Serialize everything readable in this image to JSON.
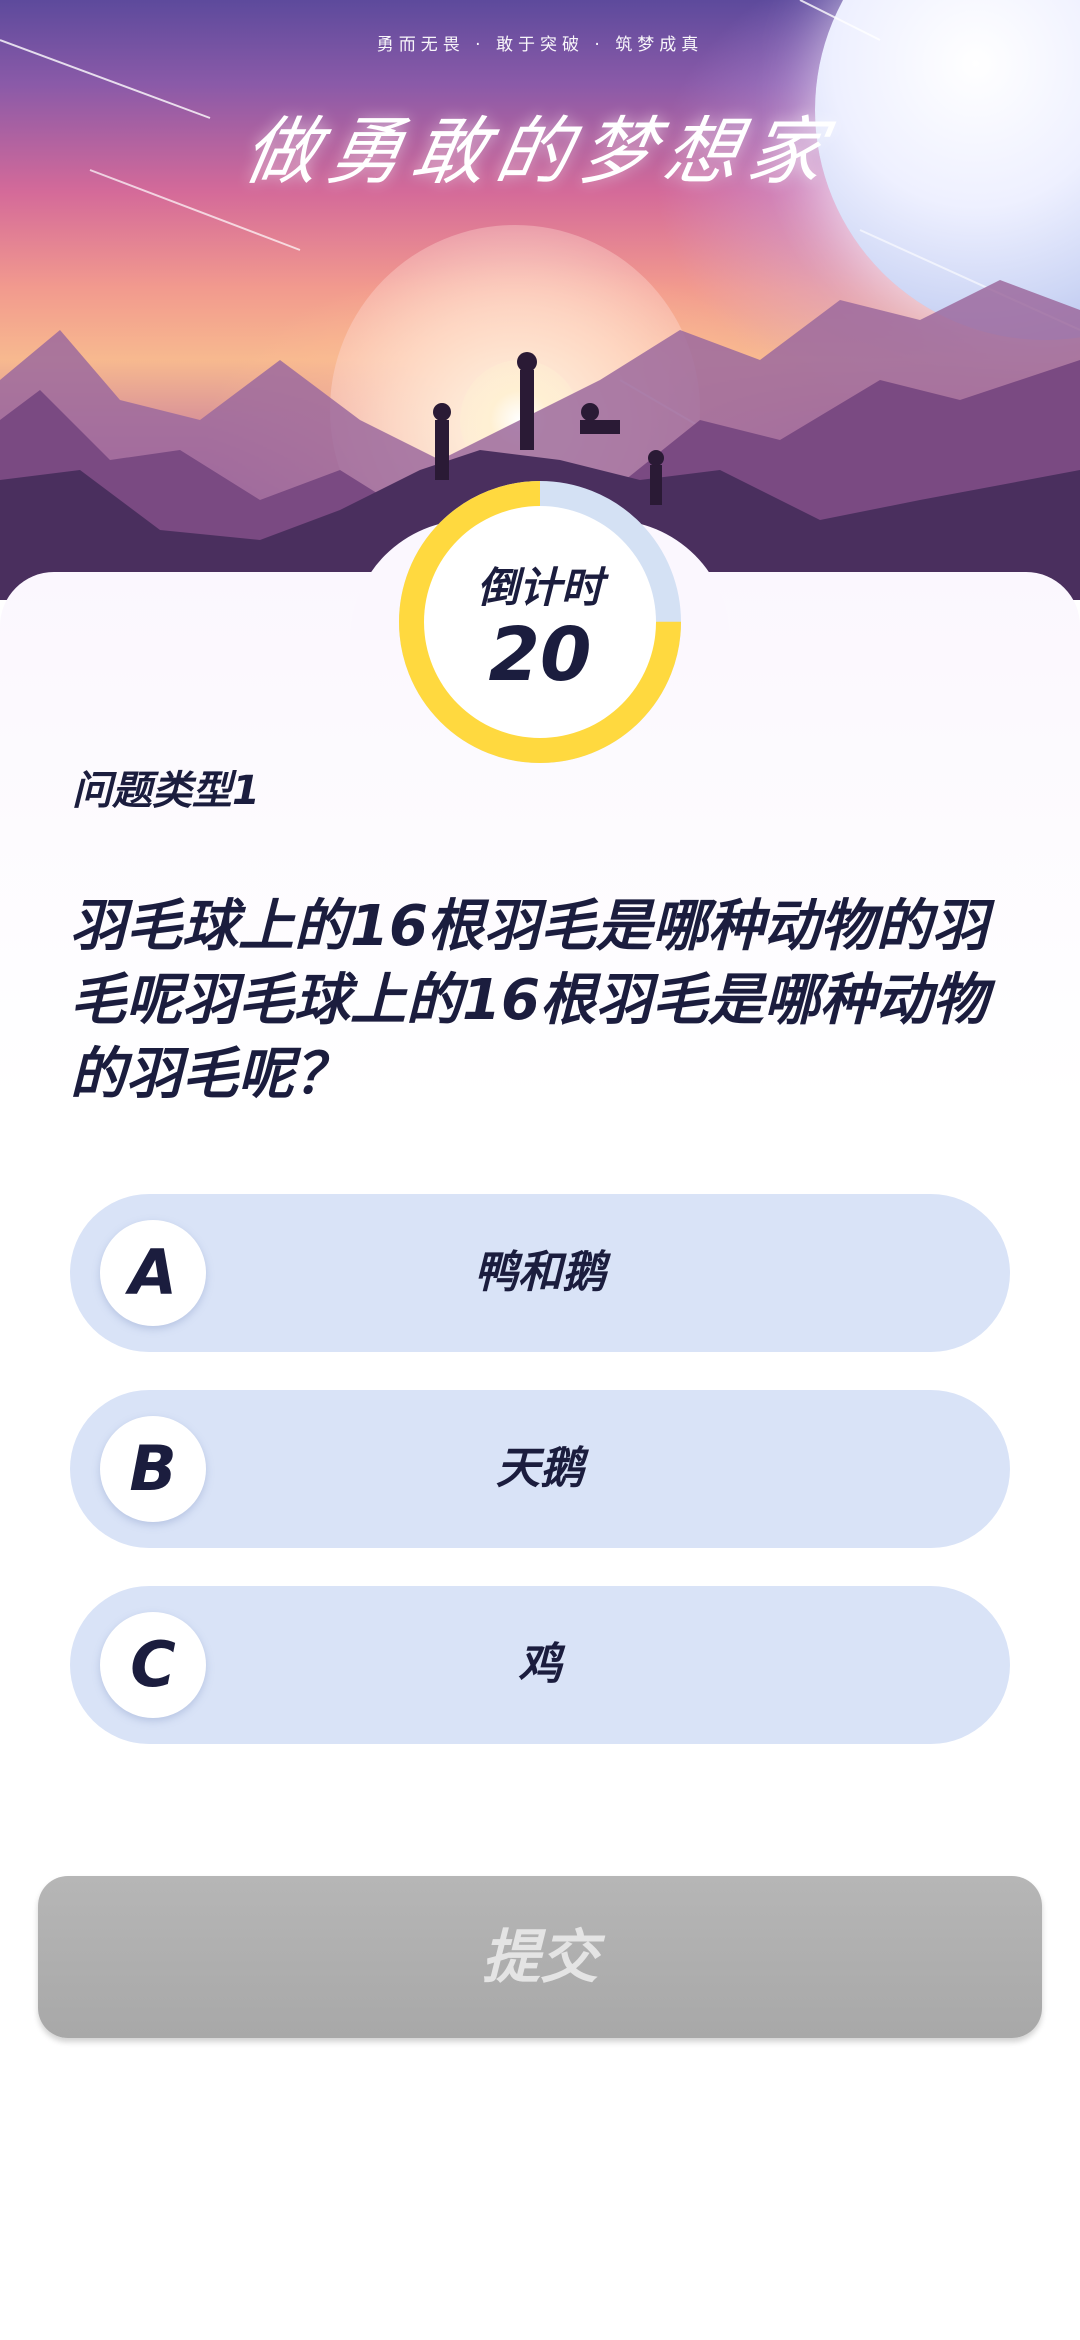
{
  "hero": {
    "slogan": "勇而无畏 · 敢于突破 · 筑梦成真",
    "title": "做勇敢的梦想家"
  },
  "countdown": {
    "label": "倒计时",
    "seconds": "20",
    "progress_fraction": 0.75,
    "ring_color": "#ffd93f",
    "track_color": "#d4e1f4"
  },
  "question": {
    "type": "问题类型1",
    "text": "羽毛球上的16根羽毛是哪种动物的羽毛呢羽毛球上的16根羽毛是哪种动物的羽毛呢？"
  },
  "options": [
    {
      "letter": "A",
      "label": "鸭和鹅"
    },
    {
      "letter": "B",
      "label": "天鹅"
    },
    {
      "letter": "C",
      "label": "鸡"
    }
  ],
  "submit": {
    "label": "提交"
  },
  "colors": {
    "text_dark": "#1b1d3e",
    "option_bg": "#d9e3f7",
    "submit_disabled_bg": "#aaaaaa"
  }
}
